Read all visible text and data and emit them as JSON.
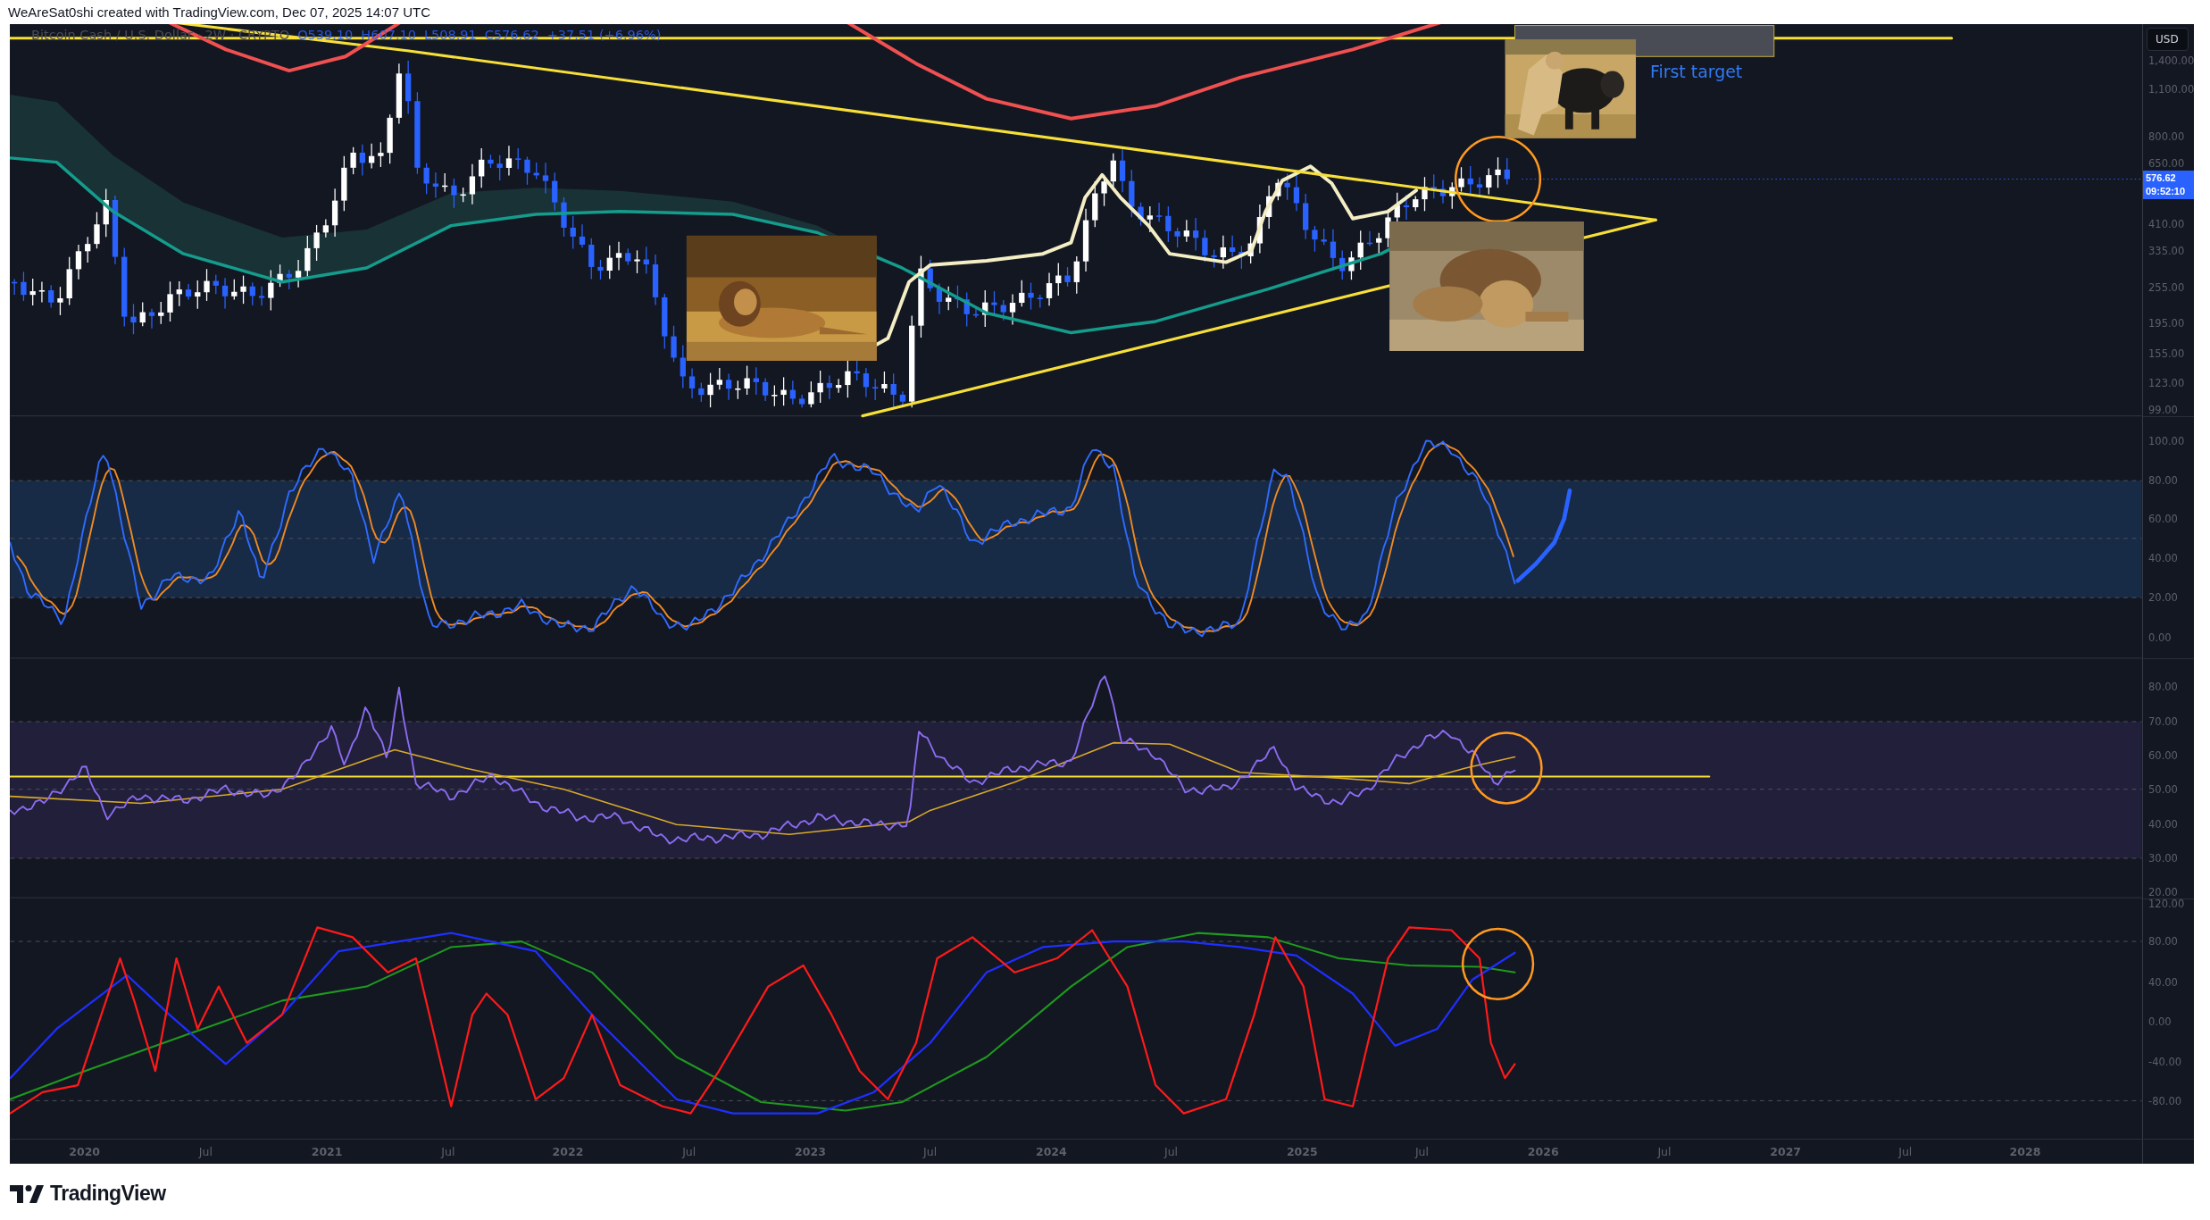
{
  "header": {
    "text": "WeAreSat0shi created with TradingView.com, Dec 07, 2025 14:07 UTC"
  },
  "legend": {
    "symbol": "Bitcoin Cash / U.S. Dollar · 2W · CRYPTO",
    "values": [
      "O539.10",
      "H607.10",
      "L508.91",
      "C576.62",
      "+37.51 (+6.96%)"
    ]
  },
  "currency": "USD",
  "last_price": {
    "price": "576.62",
    "countdown": "09:52:10"
  },
  "annotation": "First target",
  "panes": [
    {
      "kind": "price",
      "labels": [
        "1,400.00",
        "1,100.00",
        "800.00",
        "650.00",
        "410.00",
        "335.00",
        "255.00",
        "195.00",
        "155.00",
        "123.00",
        "99.00"
      ]
    },
    {
      "kind": "stoch",
      "labels": [
        "100.00",
        "80.00",
        "60.00",
        "40.00",
        "20.00",
        "0.00"
      ]
    },
    {
      "kind": "rsi",
      "labels": [
        "80.00",
        "70.00",
        "60.00",
        "50.00",
        "40.00",
        "30.00",
        "20.00"
      ]
    },
    {
      "kind": "cci",
      "labels": [
        "120.00",
        "80.00",
        "40.00",
        "0.00",
        "-40.00",
        "-80.00"
      ]
    }
  ],
  "time_axis": [
    {
      "label": "2020",
      "kind": "year"
    },
    {
      "label": "Jul",
      "kind": "month"
    },
    {
      "label": "2021",
      "kind": "year"
    },
    {
      "label": "Jul",
      "kind": "month"
    },
    {
      "label": "2022",
      "kind": "year"
    },
    {
      "label": "Jul",
      "kind": "month"
    },
    {
      "label": "2023",
      "kind": "year"
    },
    {
      "label": "Jul",
      "kind": "month"
    },
    {
      "label": "2024",
      "kind": "year"
    },
    {
      "label": "Jul",
      "kind": "month"
    },
    {
      "label": "2025",
      "kind": "year"
    },
    {
      "label": "Jul",
      "kind": "month"
    },
    {
      "label": "2026",
      "kind": "year"
    },
    {
      "label": "Jul",
      "kind": "month"
    },
    {
      "label": "2027",
      "kind": "year"
    },
    {
      "label": "Jul",
      "kind": "month"
    },
    {
      "label": "2028",
      "kind": "year"
    }
  ],
  "logo": {
    "text": "TradingView"
  }
}
